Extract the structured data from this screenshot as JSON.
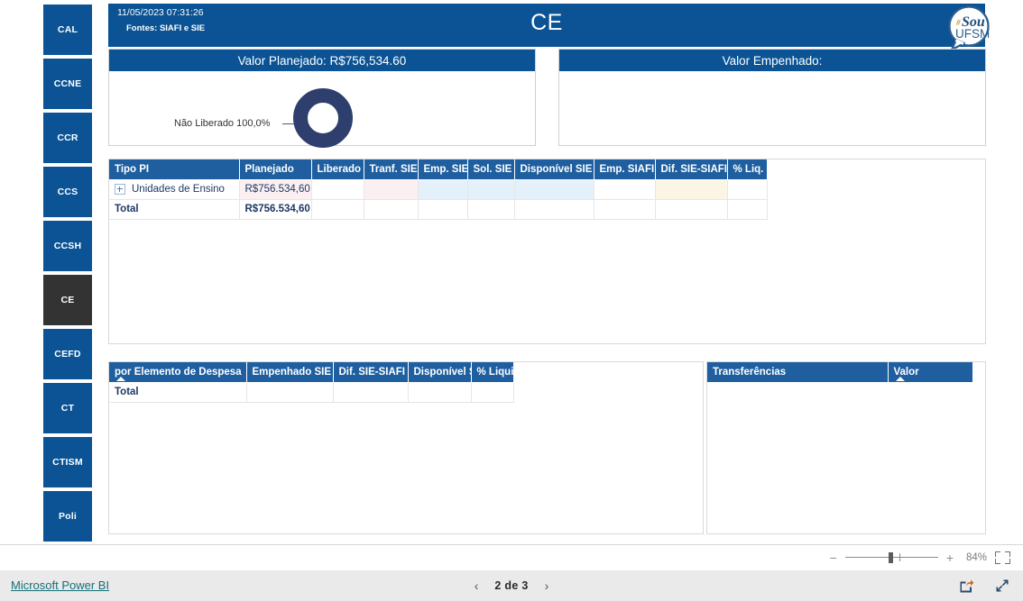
{
  "header": {
    "datetime": "11/05/2023 07:31:26",
    "sources": "Fontes: SIAFI e SIE",
    "title": "CE",
    "logo_line1": "#Sou",
    "logo_line2": "UFSM"
  },
  "sidebar": {
    "items": [
      {
        "label": "CAL",
        "selected": false
      },
      {
        "label": "CCNE",
        "selected": false
      },
      {
        "label": "CCR",
        "selected": false
      },
      {
        "label": "CCS",
        "selected": false
      },
      {
        "label": "CCSH",
        "selected": false
      },
      {
        "label": "CE",
        "selected": true
      },
      {
        "label": "CEFD",
        "selected": false
      },
      {
        "label": "CT",
        "selected": false
      },
      {
        "label": "CTISM",
        "selected": false
      },
      {
        "label": "Poli",
        "selected": false
      }
    ]
  },
  "kpi": {
    "planejado": {
      "title": "Valor Planejado: R$756,534.60",
      "donut_label": "Não Liberado 100,0%"
    },
    "empenhado": {
      "title": "Valor Empenhado:"
    }
  },
  "chart_data": {
    "type": "pie",
    "title": "Valor Planejado: R$756,534.60",
    "categories": [
      "Não Liberado"
    ],
    "values": [
      100.0
    ],
    "value_labels": [
      "Não Liberado 100,0%"
    ],
    "unit": "%",
    "colors": [
      "#2e3f6e"
    ],
    "donut": true,
    "legend": "none",
    "total": 756534.6,
    "total_formatted": "R$756,534.60"
  },
  "matrix": {
    "columns": [
      "Tipo PI",
      "Planejado",
      "Liberado",
      "Tranf. SIE",
      "Emp. SIE",
      "Sol. SIE",
      "Disponível SIE",
      "Emp. SIAFI",
      "Dif. SIE-SIAFI",
      "% Liq."
    ],
    "rows": [
      {
        "label": "Unidades de Ensino",
        "expandable": true,
        "planejado": "R$756.534,60",
        "liberado": "",
        "tranf_sie": "",
        "emp_sie": "",
        "sol_sie": "",
        "disponivel_sie": "",
        "emp_siafi": "",
        "dif_sie_siafi": "",
        "pct_liq": ""
      }
    ],
    "total": {
      "label": "Total",
      "planejado": "R$756.534,60",
      "liberado": "",
      "tranf_sie": "",
      "emp_sie": "",
      "sol_sie": "",
      "disponivel_sie": "",
      "emp_siafi": "",
      "dif_sie_siafi": "",
      "pct_liq": ""
    }
  },
  "elemento_table": {
    "columns": [
      "por Elemento de Despesa",
      "Empenhado SIE",
      "Dif. SIE-SIAFI",
      "Disponível SIE",
      "% Liquid."
    ],
    "sorted_column": "por Elemento de Despesa",
    "sort_direction": "asc",
    "rows": [],
    "total": {
      "label": "Total",
      "empenhado_sie": "",
      "dif_sie_siafi": "",
      "disponivel_sie": "",
      "pct_liquid": ""
    }
  },
  "transferencias_table": {
    "columns": [
      "Transferências",
      "Valor"
    ],
    "sorted_column": "Valor",
    "sort_direction": "asc",
    "rows": []
  },
  "status_bar": {
    "zoom_minus": "−",
    "zoom_plus": "+",
    "zoom_value": "84%"
  },
  "footer": {
    "brand_link": "Microsoft Power BI",
    "prev_arrow": "‹",
    "next_arrow": "›",
    "page_label": "2 de 3"
  },
  "colors": {
    "brand_blue": "#0b5394",
    "table_header_blue": "#1f5fa0",
    "donut_navy": "#2e3f6e",
    "selected_tab": "#333333",
    "link_teal": "#15707b"
  }
}
